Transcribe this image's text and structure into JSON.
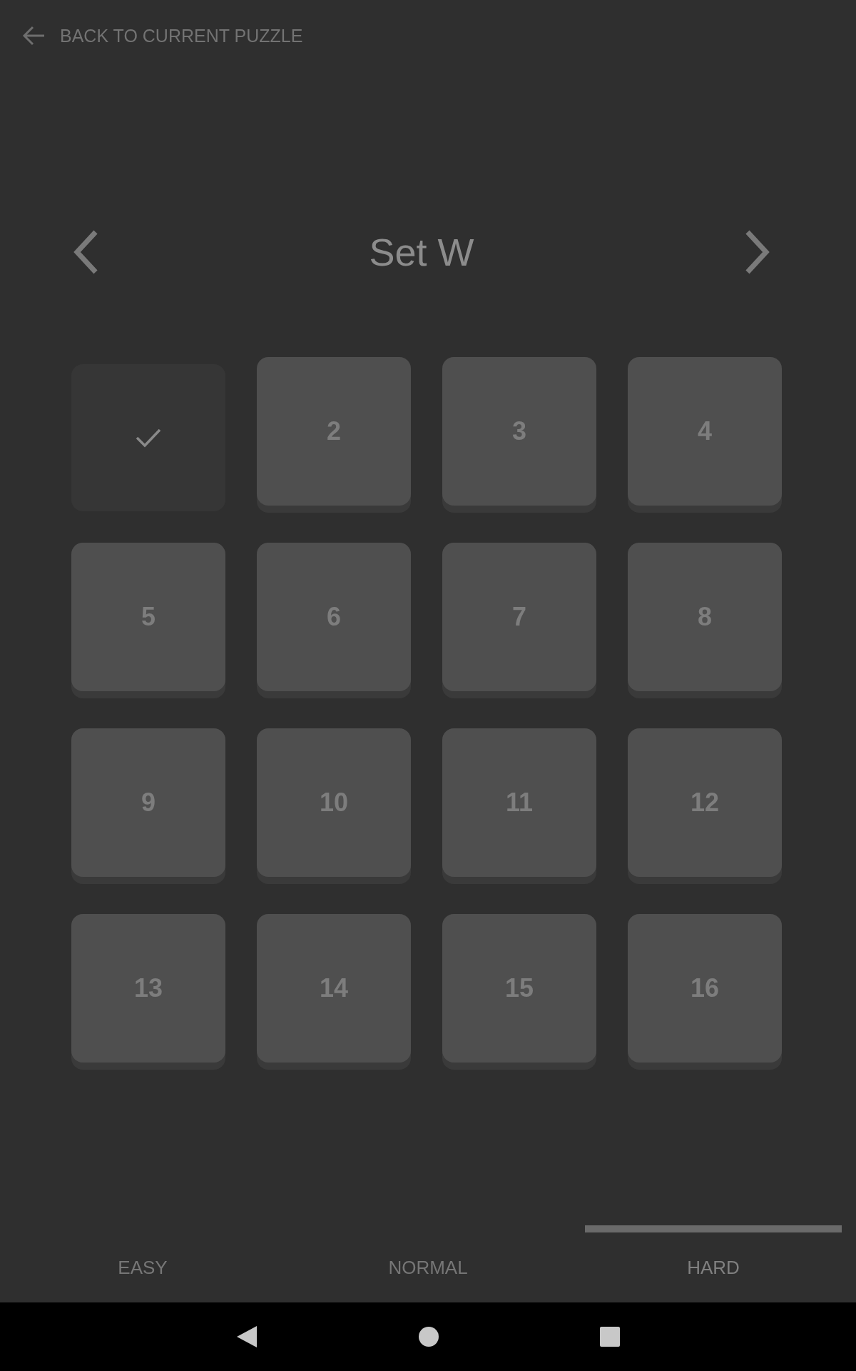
{
  "header": {
    "back_label": "BACK TO CURRENT PUZZLE"
  },
  "set_title": "Set W",
  "puzzles": [
    {
      "solved": true
    },
    {
      "label": "2",
      "solved": false
    },
    {
      "label": "3",
      "solved": false
    },
    {
      "label": "4",
      "solved": false
    },
    {
      "label": "5",
      "solved": false
    },
    {
      "label": "6",
      "solved": false
    },
    {
      "label": "7",
      "solved": false
    },
    {
      "label": "8",
      "solved": false
    },
    {
      "label": "9",
      "solved": false
    },
    {
      "label": "10",
      "solved": false
    },
    {
      "label": "11",
      "solved": false
    },
    {
      "label": "12",
      "solved": false
    },
    {
      "label": "13",
      "solved": false
    },
    {
      "label": "14",
      "solved": false
    },
    {
      "label": "15",
      "solved": false
    },
    {
      "label": "16",
      "solved": false
    }
  ],
  "tabs": [
    {
      "label": "EASY",
      "selected": false
    },
    {
      "label": "NORMAL",
      "selected": false
    },
    {
      "label": "HARD",
      "selected": true
    }
  ]
}
